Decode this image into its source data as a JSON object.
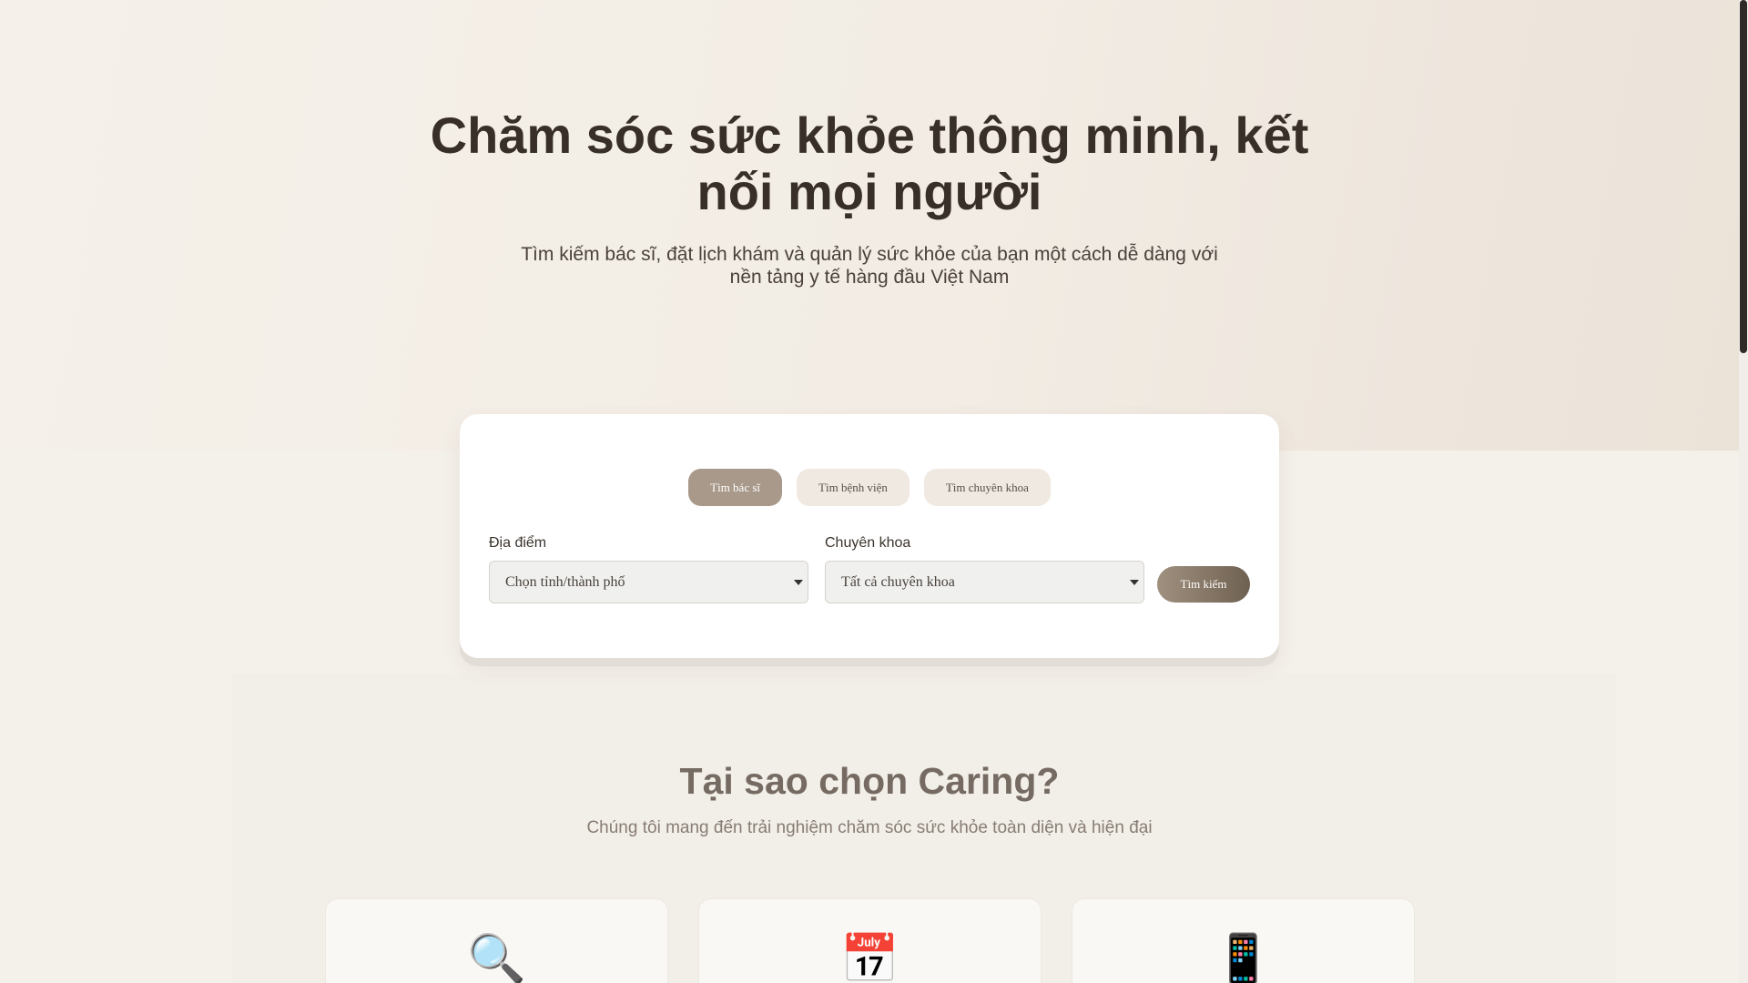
{
  "hero": {
    "title": "Chăm sóc sức khỏe thông minh, kết nối mọi người",
    "subtitle": "Tìm kiếm bác sĩ, đặt lịch khám và quản lý sức khỏe của bạn một cách dễ dàng với nền tảng y tế hàng đầu Việt Nam"
  },
  "search": {
    "tabs": [
      {
        "label": "Tìm bác sĩ",
        "active": true
      },
      {
        "label": "Tìm bệnh viện",
        "active": false
      },
      {
        "label": "Tìm chuyên khoa",
        "active": false
      }
    ],
    "location_label": "Địa điểm",
    "location_value": "Chọn tỉnh/thành phố",
    "specialty_label": "Chuyên khoa",
    "specialty_value": "Tất cả chuyên khoa",
    "button_label": "Tìm kiếm"
  },
  "why": {
    "title": "Tại sao chọn Caring?",
    "subtitle": "Chúng tôi mang đến trải nghiệm chăm sóc sức khỏe toàn diện và hiện đại"
  },
  "features": [
    {
      "icon": "magnifying-glass-icon",
      "glyph": "🔍"
    },
    {
      "icon": "calendar-icon",
      "glyph": "📅"
    },
    {
      "icon": "mobile-phone-icon",
      "glyph": "📱"
    }
  ],
  "colors": {
    "accent": "#a8998b",
    "button_gradient_start": "#a0907f",
    "button_gradient_end": "#6f6151",
    "heading": "#382f28"
  }
}
